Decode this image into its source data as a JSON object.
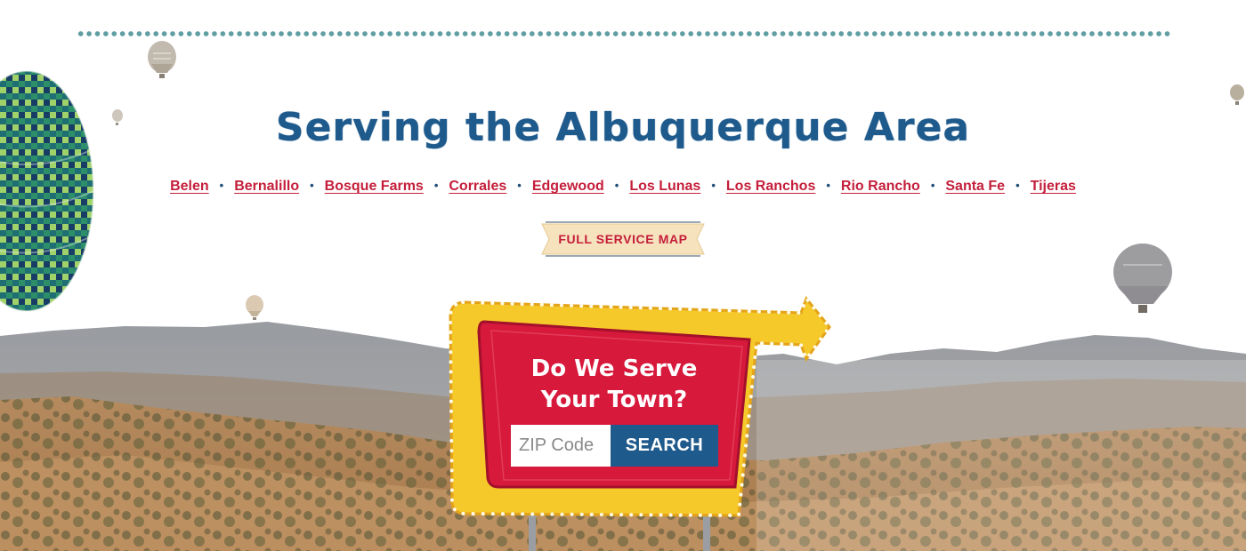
{
  "section": {
    "heading": "Serving the Albuquerque Area",
    "towns": [
      "Belen",
      "Bernalillo",
      "Bosque Farms",
      "Corrales",
      "Edgewood",
      "Los Lunas",
      "Los Ranchos",
      "Rio Rancho",
      "Santa Fe",
      "Tijeras"
    ],
    "separator": "•",
    "map_button_label": "FULL SERVICE MAP"
  },
  "sign": {
    "title_line1": "Do We Serve",
    "title_line2": "Your Town?",
    "zip_placeholder": "ZIP Code",
    "zip_value": "",
    "search_label": "SEARCH"
  },
  "colors": {
    "heading_blue": "#1f5a8c",
    "link_red": "#c41e3a",
    "sign_red": "#d7193c",
    "sign_yellow": "#f6c92a",
    "dots_teal": "#5f9ea3",
    "banner_cream": "#f6e2bd"
  },
  "icons": [
    "hot-air-balloon-icon",
    "dotted-divider"
  ]
}
